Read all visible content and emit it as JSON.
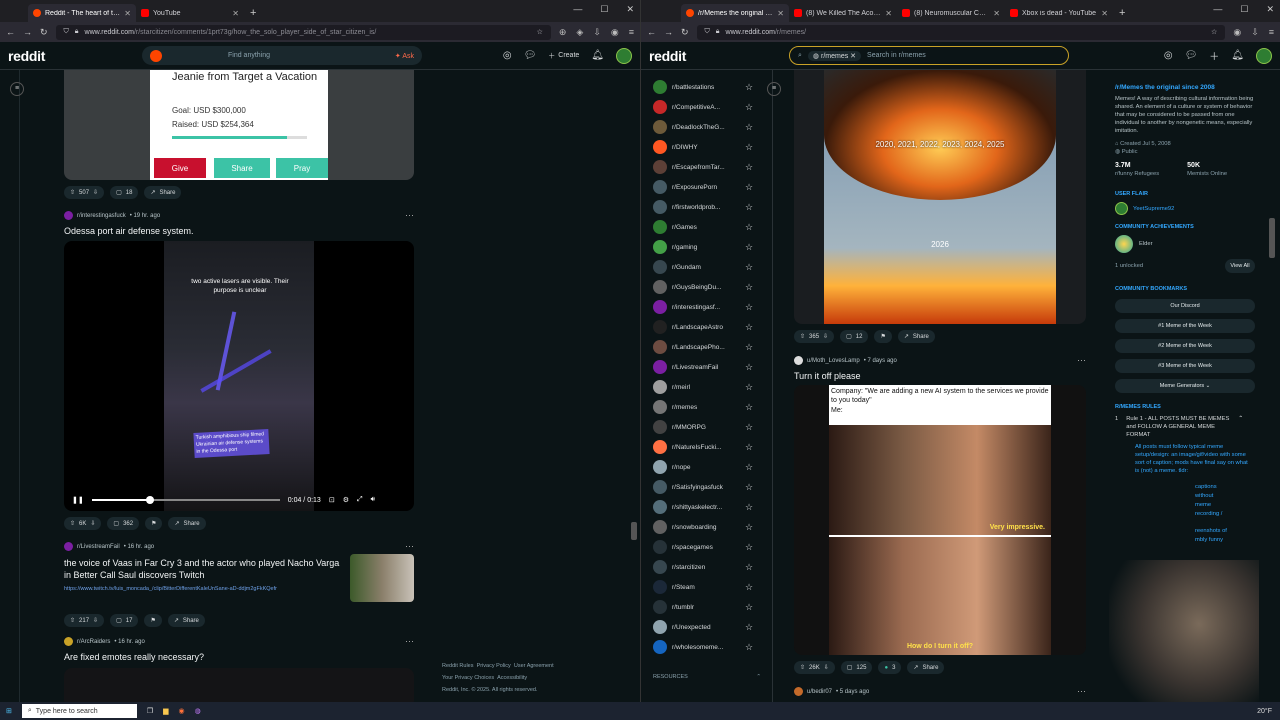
{
  "left": {
    "tabs": [
      {
        "title": "Reddit - The heart of the internet",
        "active": true,
        "color": "#ff4500"
      },
      {
        "title": "YouTube",
        "active": false,
        "color": "#ff0000"
      }
    ],
    "url_main": "www.reddit.com",
    "url_rest": "/r/starcitizen/comments/1prt73g/how_the_solo_player_side_of_star_citizen_is/",
    "search_placeholder": "Find anything",
    "ask_label": "Ask",
    "create_label": "Create",
    "post0": {
      "card_title": "Jeanie from Target a Vacation",
      "goal": "Goal: USD $300,000",
      "raised": "Raised: USD $254,364",
      "buttons": [
        "Give",
        "Share",
        "Pray"
      ],
      "votes": "507",
      "comments": "18",
      "share": "Share"
    },
    "post1": {
      "subreddit": "r/interestingasfuck",
      "age": "• 19 hr. ago",
      "title": "Odessa port air defense system.",
      "overlay_top": "two active lasers are visible. Their purpose is unclear",
      "overlay_bottom": "Turkish amphibious ship filmed Ukrainian air defense systems in the Odessa port",
      "time": "0:04 / 0:13",
      "progress": 0.31,
      "votes": "6K",
      "comments": "362",
      "share": "Share"
    },
    "post2": {
      "subreddit": "r/LivestreamFail",
      "age": "• 16 hr. ago",
      "title": "the voice of Vaas in Far Cry 3 and the actor who played Nacho Varga in Better Call Saul discovers Twitch",
      "link": "https://www.twitch.tv/luis_moncada_/clip/BitterDifferentKaleUnSane-aD-ddjm2gFkKQefr",
      "votes": "217",
      "comments": "17",
      "share": "Share"
    },
    "post3": {
      "subreddit": "r/ArcRaiders",
      "age": "• 16 hr. ago",
      "title": "Are fixed emotes really necessary?"
    },
    "footer": [
      "Reddit Rules",
      "Privacy Policy",
      "User Agreement",
      "Your Privacy Choices",
      "Accessibility",
      "Reddit, Inc. © 2025. All rights reserved."
    ]
  },
  "right": {
    "tabs": [
      {
        "title": "/r/Memes the original since 2008",
        "active": true,
        "color": "#ff4500"
      },
      {
        "title": "(8) We Killed The Acolyte, Appa",
        "active": false,
        "color": "#ff0000"
      },
      {
        "title": "(8) Neuromuscular Cyborg Arm",
        "active": false,
        "color": "#ff0000"
      },
      {
        "title": "Xbox is dead - YouTube",
        "active": false,
        "color": "#ff0000"
      }
    ],
    "url_main": "www.reddit.com",
    "url_rest": "/r/memes/",
    "search_chip": "r/memes",
    "search_placeholder": "Search in r/memes",
    "subs": [
      {
        "name": "r/battlestations",
        "color": "#2e7d32"
      },
      {
        "name": "r/CompetitiveA...",
        "color": "#c62828"
      },
      {
        "name": "r/DeadlockTheG...",
        "color": "#6d5a3a"
      },
      {
        "name": "r/DIWHY",
        "color": "#ff5722"
      },
      {
        "name": "r/EscapefromTar...",
        "color": "#5d4037"
      },
      {
        "name": "r/ExposurePorn",
        "color": "#455a64"
      },
      {
        "name": "r/firstworldprob...",
        "color": "#455a64"
      },
      {
        "name": "r/Games",
        "color": "#2e7d32"
      },
      {
        "name": "r/gaming",
        "color": "#43a047"
      },
      {
        "name": "r/Gundam",
        "color": "#37474f"
      },
      {
        "name": "r/GuysBeingDu...",
        "color": "#616161"
      },
      {
        "name": "r/interestingasf...",
        "color": "#7b1fa2"
      },
      {
        "name": "r/LandscapeAstro",
        "color": "#212121"
      },
      {
        "name": "r/LandscapePho...",
        "color": "#6d4c41"
      },
      {
        "name": "r/LivestreamFail",
        "color": "#7b1fa2"
      },
      {
        "name": "r/meirl",
        "color": "#9e9e9e"
      },
      {
        "name": "r/memes",
        "color": "#757575"
      },
      {
        "name": "r/MMORPG",
        "color": "#424242"
      },
      {
        "name": "r/NatureIsFucki...",
        "color": "#ff7043"
      },
      {
        "name": "r/nope",
        "color": "#90a4ae"
      },
      {
        "name": "r/Satisfyingasfuck",
        "color": "#455a64"
      },
      {
        "name": "r/shittyaskelectr...",
        "color": "#546e7a"
      },
      {
        "name": "r/snowboarding",
        "color": "#616161"
      },
      {
        "name": "r/spacegames",
        "color": "#263238"
      },
      {
        "name": "r/starcitizen",
        "color": "#37474f"
      },
      {
        "name": "r/Steam",
        "color": "#1b2838"
      },
      {
        "name": "r/tumblr",
        "color": "#263238"
      },
      {
        "name": "r/Unexpected",
        "color": "#90a4ae"
      },
      {
        "name": "r/wholesomeme...",
        "color": "#1565c0"
      }
    ],
    "resources_label": "RESOURCES",
    "meme1": {
      "text_top": "2020, 2021, 2022, 2023, 2024, 2025",
      "text_mid": "2026",
      "votes": "365",
      "comments": "12",
      "share": "Share"
    },
    "meme2": {
      "user": "u/Moth_LovesLamp",
      "age": "• 7 days ago",
      "title": "Turn it off please",
      "caption1": "Company: \"We are adding a new AI system to the services we provide to you today\"",
      "caption2": "Me:",
      "sub1": "Very impressive.",
      "sub2": "How do I turn it off?",
      "votes": "26K",
      "comments": "125",
      "awards": "3",
      "share": "Share"
    },
    "meme3": {
      "user": "u/bedir07",
      "age": "• 5 days ago"
    },
    "sidebar": {
      "title": "/r/Memes the original since 2008",
      "desc": "Memes! A way of describing cultural information being shared. An element of a culture or system of behavior that may be considered to be passed from one individual to another by nongenetic means, especially imitation.",
      "created": "Created Jul 5, 2008",
      "public": "Public",
      "members": "3.7M",
      "members_label": "r/funny Refugees",
      "online": "50K",
      "online_label": "Memists Online",
      "user_flair_h": "USER FLAIR",
      "user_name": "YeetSupreme92",
      "achievements_h": "COMMUNITY ACHIEVEMENTS",
      "achievement": "Elder",
      "unlocked": "1 unlocked",
      "view_all": "View All",
      "bookmarks_h": "COMMUNITY BOOKMARKS",
      "bookmarks": [
        "Our Discord",
        "#1 Meme of the Week",
        "#2 Meme of the Week",
        "#3 Meme of the Week",
        "Meme Generators"
      ],
      "rules_h": "R/MEMES RULES",
      "rule1": "Rule 1 - ALL POSTS MUST BE MEMES and FOLLOW A GENERAL MEME FORMAT",
      "rule1_body": "All posts must follow typical meme setup/design: an image/gif/video with some sort of caption; mods have final say on what is (not) a meme. tldr:",
      "rule_frag": [
        "captions",
        "without",
        "meme",
        "recording /",
        "reenshots of",
        "mbly funny"
      ]
    }
  },
  "taskbar": {
    "search": "Type here to search",
    "weather": "20°F"
  }
}
